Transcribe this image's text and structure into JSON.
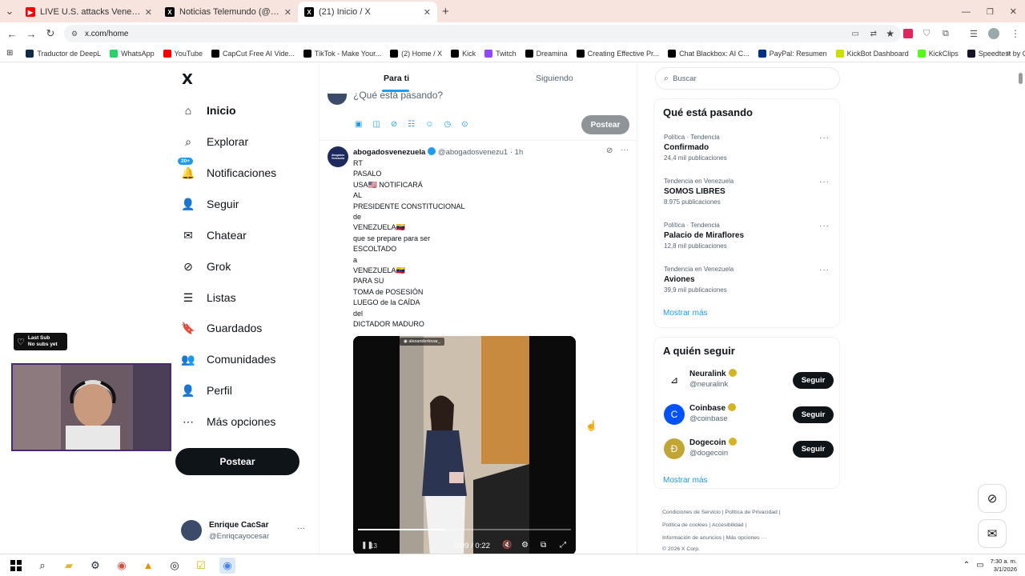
{
  "browser": {
    "tabs": [
      {
        "title": "LIVE U.S. attacks Venezuela, Tru",
        "favicon_color": "#ff0000",
        "active": false
      },
      {
        "title": "Noticias Telemundo (@noticiast",
        "favicon_color": "#000000",
        "active": false
      },
      {
        "title": "(21) Inicio / X",
        "favicon_color": "#000000",
        "active": true
      }
    ],
    "new_tab": "+",
    "url": "x.com/home",
    "bookmarks": [
      {
        "label": "Traductor de DeepL",
        "color": "#0f2b46"
      },
      {
        "label": "WhatsApp",
        "color": "#25d366"
      },
      {
        "label": "YouTube",
        "color": "#ff0000"
      },
      {
        "label": "CapCut Free AI Vide...",
        "color": "#000000"
      },
      {
        "label": "TikTok - Make Your...",
        "color": "#000000"
      },
      {
        "label": "(2) Home / X",
        "color": "#000000"
      },
      {
        "label": "Kick",
        "color": "#000000"
      },
      {
        "label": "Twitch",
        "color": "#9146ff"
      },
      {
        "label": "Dreamina",
        "color": "#000000"
      },
      {
        "label": "Creating Effective Pr...",
        "color": "#000000"
      },
      {
        "label": "Chat Blackbox: AI C...",
        "color": "#000000"
      },
      {
        "label": "PayPal: Resumen",
        "color": "#003087"
      },
      {
        "label": "KickBot Dashboard",
        "color": "#c9e000"
      },
      {
        "label": "KickClips",
        "color": "#53fc18"
      },
      {
        "label": "Speedtest by Ookla...",
        "color": "#141526"
      }
    ]
  },
  "sidebar": {
    "logo": "X",
    "items": [
      {
        "label": "Inicio",
        "icon": "home-icon",
        "glyph": "⌂"
      },
      {
        "label": "Explorar",
        "icon": "search-icon",
        "glyph": "⌕"
      },
      {
        "label": "Notificaciones",
        "icon": "bell-icon",
        "glyph": "🔔",
        "badge": "20+"
      },
      {
        "label": "Seguir",
        "icon": "add-person-icon",
        "glyph": "👤"
      },
      {
        "label": "Chatear",
        "icon": "mail-icon",
        "glyph": "✉"
      },
      {
        "label": "Grok",
        "icon": "grok-icon",
        "glyph": "⊘"
      },
      {
        "label": "Listas",
        "icon": "list-icon",
        "glyph": "☰"
      },
      {
        "label": "Guardados",
        "icon": "bookmark-icon",
        "glyph": "🔖"
      },
      {
        "label": "Comunidades",
        "icon": "communities-icon",
        "glyph": "👥"
      },
      {
        "label": "Perfil",
        "icon": "profile-icon",
        "glyph": "👤"
      },
      {
        "label": "Más opciones",
        "icon": "more-circle-icon",
        "glyph": "⋯"
      }
    ],
    "post_button": "Postear",
    "account": {
      "name": "Enrique CacSar",
      "handle": "@Enriqcayocesar"
    }
  },
  "overlay": {
    "badge_line1": "Last Sub",
    "badge_line2": "No subs yet"
  },
  "feed": {
    "tabs": [
      "Para ti",
      "Siguiendo"
    ],
    "composer_placeholder": "¿Qué está pasando?",
    "composer_post": "Postear",
    "tweet": {
      "name": "abogadosvenezuela",
      "handle": "@abogadosvenezu1",
      "time": "· 1h",
      "avatar_label": "Abogados Venezuela",
      "lines": [
        "RT",
        "PASALO",
        "USA🇺🇸 NOTIFICARÁ",
        "AL",
        "PRESIDENTE CONSTITUCIONAL",
        "de",
        "VENEZUELA🇻🇪",
        "que se prepare para ser",
        "ESCOLTADO",
        "a",
        "VENEZUELA🇻🇪",
        "PARA SU",
        "TOMA de POSESIÓN",
        "LUEGO de la CAÍDA",
        "del",
        "DICTADOR MADURO"
      ],
      "video": {
        "watermark": "alexandertovar_",
        "time": "0:09 / 0:22",
        "views": "13",
        "progress": 0.41
      }
    }
  },
  "right": {
    "search_placeholder": "Buscar",
    "trends_title": "Qué está pasando",
    "trends": [
      {
        "context": "Política · Tendencia",
        "name": "Confirmado",
        "count": "24,4 mil publicaciones"
      },
      {
        "context": "Tendencia en Venezuela",
        "name": "SOMOS LIBRES",
        "count": "8.975 publicaciones"
      },
      {
        "context": "Política · Tendencia",
        "name": "Palacio de Miraflores",
        "count": "12,8 mil publicaciones"
      },
      {
        "context": "Tendencia en Venezuela",
        "name": "Aviones",
        "count": "39,9 mil publicaciones"
      }
    ],
    "show_more": "Mostrar más",
    "follow_title": "A quién seguir",
    "follow": [
      {
        "name": "Neuralink",
        "handle": "@neuralink",
        "button": "Seguir",
        "avatar_bg": "#ffffff",
        "avatar_glyph": "⊿"
      },
      {
        "name": "Coinbase",
        "handle": "@coinbase",
        "button": "Seguir",
        "avatar_bg": "#0052ff",
        "avatar_glyph": "C"
      },
      {
        "name": "Dogecoin",
        "handle": "@dogecoin",
        "button": "Seguir",
        "avatar_bg": "#c2a633",
        "avatar_glyph": "Ð"
      }
    ],
    "show_more_2": "Mostrar más",
    "footer": {
      "line1a": "Condiciones de Servicio",
      "line1b": "Política de Privacidad",
      "line2a": "Política de cookies",
      "line2b": "Accesibilidad",
      "line3a": "Información de anuncios",
      "line3b": "Más opciones ···",
      "copyright": "© 2026 X Corp."
    }
  },
  "taskbar": {
    "time": "7:30 a. m.",
    "date": "3/1/2026"
  }
}
